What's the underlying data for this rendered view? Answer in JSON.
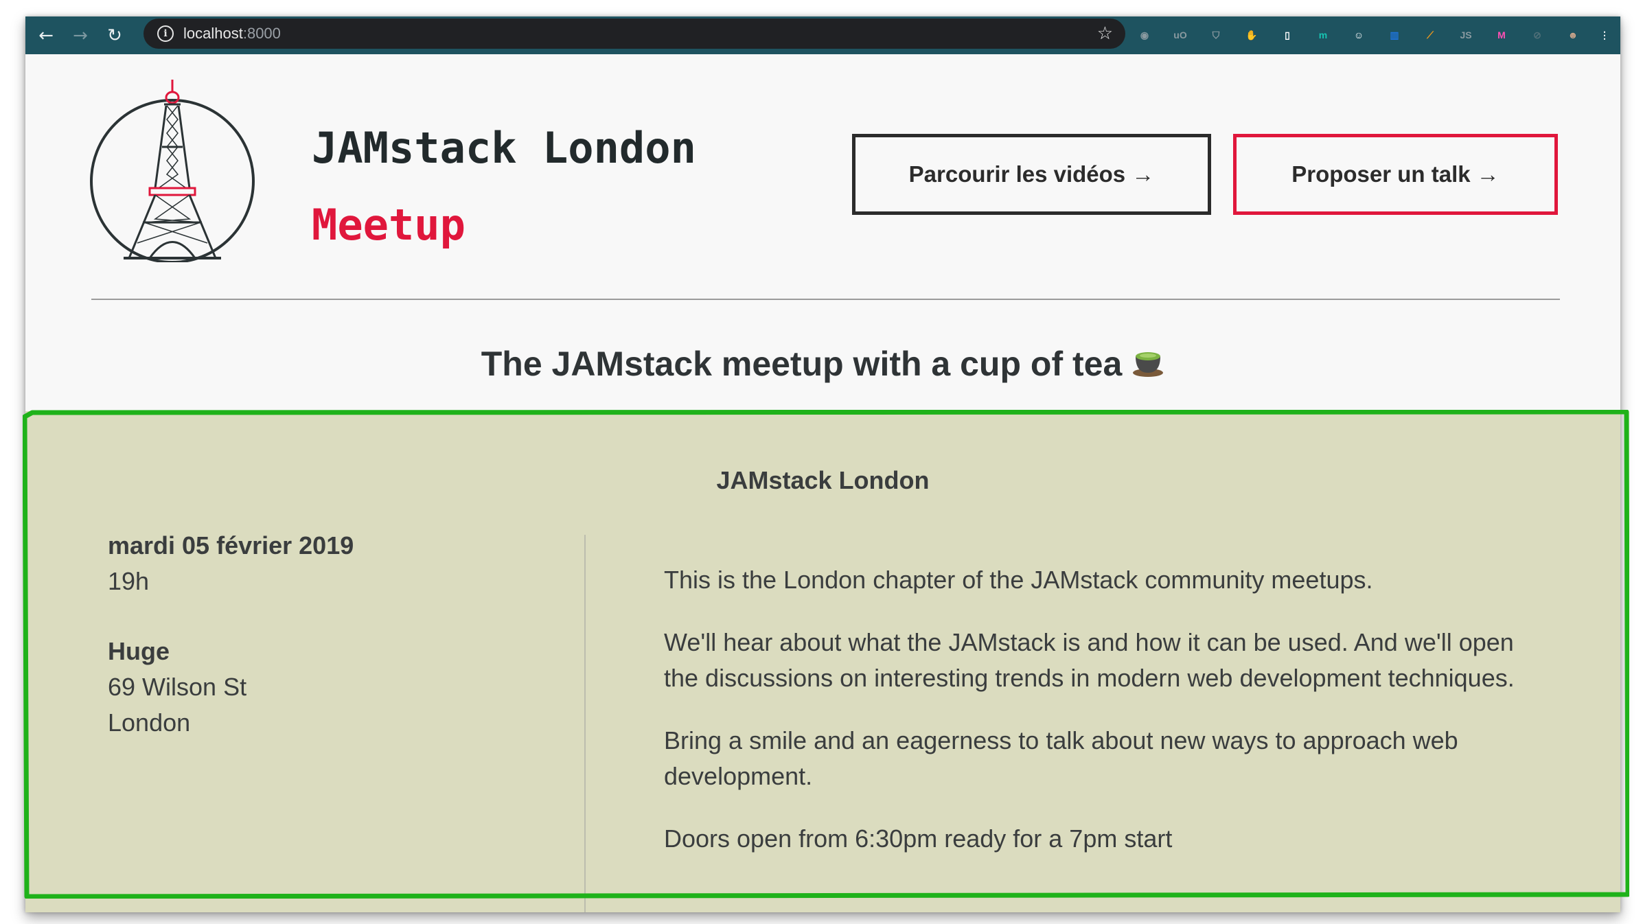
{
  "browser": {
    "url_host": "localhost",
    "url_port": ":8000",
    "back_icon": "arrow-left-icon",
    "forward_icon": "arrow-right-icon",
    "reload_icon": "reload-icon",
    "star_icon": "star-icon",
    "extensions": [
      {
        "name": "camera-extension-icon",
        "glyph": "◉",
        "color": "#8a9aa0"
      },
      {
        "name": "ublock-extension-icon",
        "glyph": "uO",
        "color": "#8a9aa0"
      },
      {
        "name": "pocket-extension-icon",
        "glyph": "⛉",
        "color": "#8a9aa0"
      },
      {
        "name": "hand-extension-icon",
        "glyph": "✋",
        "color": "#ffffff"
      },
      {
        "name": "document-extension-icon",
        "glyph": "▯",
        "color": "#ffffff"
      },
      {
        "name": "grammarly-extension-icon",
        "glyph": "m",
        "color": "#17c3b2"
      },
      {
        "name": "emoji-extension-icon",
        "glyph": "☺",
        "color": "#ffffff"
      },
      {
        "name": "trello-extension-icon",
        "glyph": "▥",
        "color": "#1f73d8"
      },
      {
        "name": "eyedropper-extension-icon",
        "glyph": "⟋",
        "color": "#f29a1a"
      },
      {
        "name": "js-extension-icon",
        "glyph": "JS",
        "color": "#8a9aa0"
      },
      {
        "name": "m-extension-icon",
        "glyph": "M",
        "color": "#ff4fb4"
      },
      {
        "name": "disabled-extension-icon",
        "glyph": "⊘",
        "color": "#4f6f78"
      },
      {
        "name": "profile-avatar-icon",
        "glyph": "☻",
        "color": "#c8a38a"
      },
      {
        "name": "menu-kebab-icon",
        "glyph": "⋮",
        "color": "#ffffff"
      }
    ]
  },
  "header": {
    "title": "JAMstack London",
    "subtitle": "Meetup",
    "logo_icon": "eiffel-tower-icon",
    "buttons": {
      "videos": "Parcourir les vidéos →",
      "propose": "Proposer un talk →"
    }
  },
  "tagline": {
    "text": "The JAMstack meetup with a cup of tea",
    "emoji_icon": "tea-cup-icon"
  },
  "event": {
    "title": "JAMstack London",
    "date": "mardi 05 février 2019",
    "time": "19h",
    "venue": "Huge",
    "address_line1": "69 Wilson St",
    "address_line2": "London",
    "description": [
      "This is the London chapter of the JAMstack community meetups.",
      "We'll hear about what the JAMstack is and how it can be used. And we'll open the discussions on interesting trends in modern web development techniques.",
      "Bring a smile and an eagerness to talk about new ways to approach web development.",
      "Doors open from 6:30pm ready for a 7pm start"
    ]
  },
  "colors": {
    "accent_red": "#e0173c",
    "panel_bg": "#dbdcbf",
    "highlight_green": "#1fb21a",
    "toolbar_bg": "#1e5360"
  }
}
